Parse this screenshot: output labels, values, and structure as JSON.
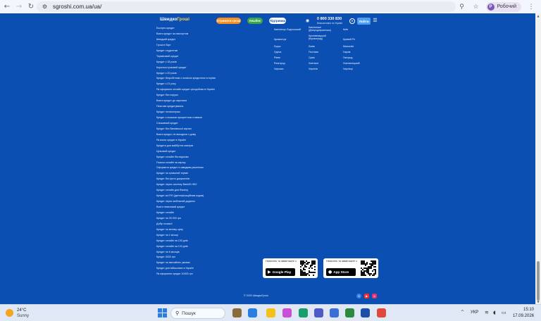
{
  "browser": {
    "url": "sgroshi.com.ua/ua/",
    "profile_initial": "Р",
    "profile_name": "Робочий",
    "back_icon": "back-arrow-icon",
    "forward_icon": "forward-arrow-icon",
    "reload_icon": "reload-icon"
  },
  "header": {
    "logo_main": "Швидко",
    "logo_accent": "Гроші",
    "pill_orange": "Отримати гроші",
    "pill_green": "Кешбек",
    "pill_outline": "Підтримка",
    "phone": "0 800 330 830",
    "phone_note": "Безкоштовно по Україні",
    "login": "Увійти"
  },
  "loan_links": [
    "Експрес кредит",
    "Взяти кредит за паспортом",
    "Швидкий кредит",
    "Гроші в борг",
    "Кредит студентам",
    "Терміновий кредит",
    "Кредит з 18 років",
    "Короткостроковий кредит",
    "Кредит з 20 років",
    "Кредит безробітним з поганою кредитною історією",
    "Кредит з 21 року",
    "Як оформити онлайн кредит цілодобово в Україні",
    "Кредит без поруки",
    "Взяти кредит до зарплати",
    "Пільгове кредитування",
    "Кредит пенсіонерам",
    "Кредит з низькою процентною ставкою",
    "Споживчий кредит",
    "Кредит без банківської картки",
    "Взяти кредит, не виходячи з дому",
    "Як взяти кредит в Україні",
    "Кредити для майбутніх матерів",
    "Цільовий кредит",
    "Кредит онлайн без відмови",
    "Позики онлайн на картку",
    "Оформити кредит із швидким рішенням",
    "Кредит на тривалий термін",
    "Кредит без фото документів",
    "Кредит через систему BankID НБУ",
    "Кредит онлайн для бізнесу",
    "Кредит за ІПН (ідентифікаційним кодом)",
    "Кредит через мобільний додаток",
    "Взяти невеликий кредит",
    "Кредит онлайн",
    "Кредит на 30 000 грн",
    "Добір позикої",
    "Кредит на велику суму",
    "Кредит на 2 місяці",
    "Кредит онлайн на 100 днів",
    "Кредит онлайн на 120 днів",
    "Кредит на 6 місяців",
    "Кредит 3000 грн",
    "Кредит на звичайних умовах",
    "Кредит для військових в Україні",
    "Як оформити кредит 10000 грн"
  ],
  "cities_col1": [
    "Кам'янець-Подільський",
    "Кременчук",
    "Луцьк",
    "Одеса",
    "Рівне",
    "Ромгород",
    "Черкаси"
  ],
  "cities_col2": [
    "Кам'янське (Дніпродзержинськ)",
    "Кропивницький (Кіровоград)",
    "Львів",
    "Полтава",
    "Суми",
    "Хмельне",
    "Чернігів"
  ],
  "cities_col3": [
    "Київ",
    "Кривий Ріг",
    "Миколаїв",
    "Харків",
    "Ужгород",
    "Хмельницький",
    "Чернівці"
  ],
  "apps": {
    "cta": "Натисніть та завантажте з",
    "google": "Google Play",
    "apple": "App Store"
  },
  "copyright": "© 2026 ШвидкоГроші",
  "taskbar": {
    "temp": "24°C",
    "weather": "Sunny",
    "search": "Пошук",
    "lang": "УКР",
    "time": "15:10",
    "date": "17.09.2026"
  },
  "colors": {
    "page_bg": "#0b4fb3",
    "accent_yellow": "#ffd34d",
    "orange": "#f78f1e",
    "green": "#3ba64a",
    "login": "#4c9ef0"
  }
}
